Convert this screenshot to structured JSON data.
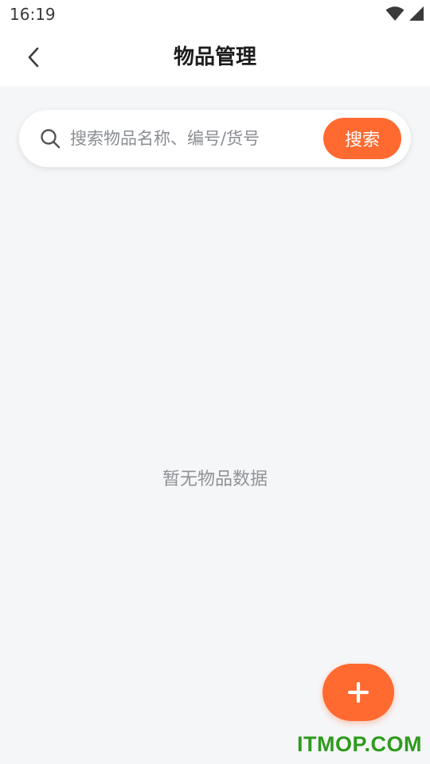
{
  "status_bar": {
    "time": "16:19",
    "icons": [
      "wifi-icon",
      "cellular-signal-icon",
      "battery-charging-icon"
    ]
  },
  "header": {
    "title": "物品管理",
    "back_icon": "chevron-left-icon"
  },
  "search": {
    "placeholder": "搜索物品名称、编号/货号",
    "value": "",
    "button_label": "搜索",
    "icon": "search-icon"
  },
  "empty_state": {
    "message": "暂无物品数据"
  },
  "fab": {
    "icon": "plus-icon"
  },
  "watermark": {
    "text": "ITMOP.COM"
  },
  "colors": {
    "accent": "#ff6a30",
    "background": "#f5f6f8",
    "title": "#1c1c1c",
    "muted_text": "#8f9296",
    "watermark": "#2e9a1e"
  }
}
